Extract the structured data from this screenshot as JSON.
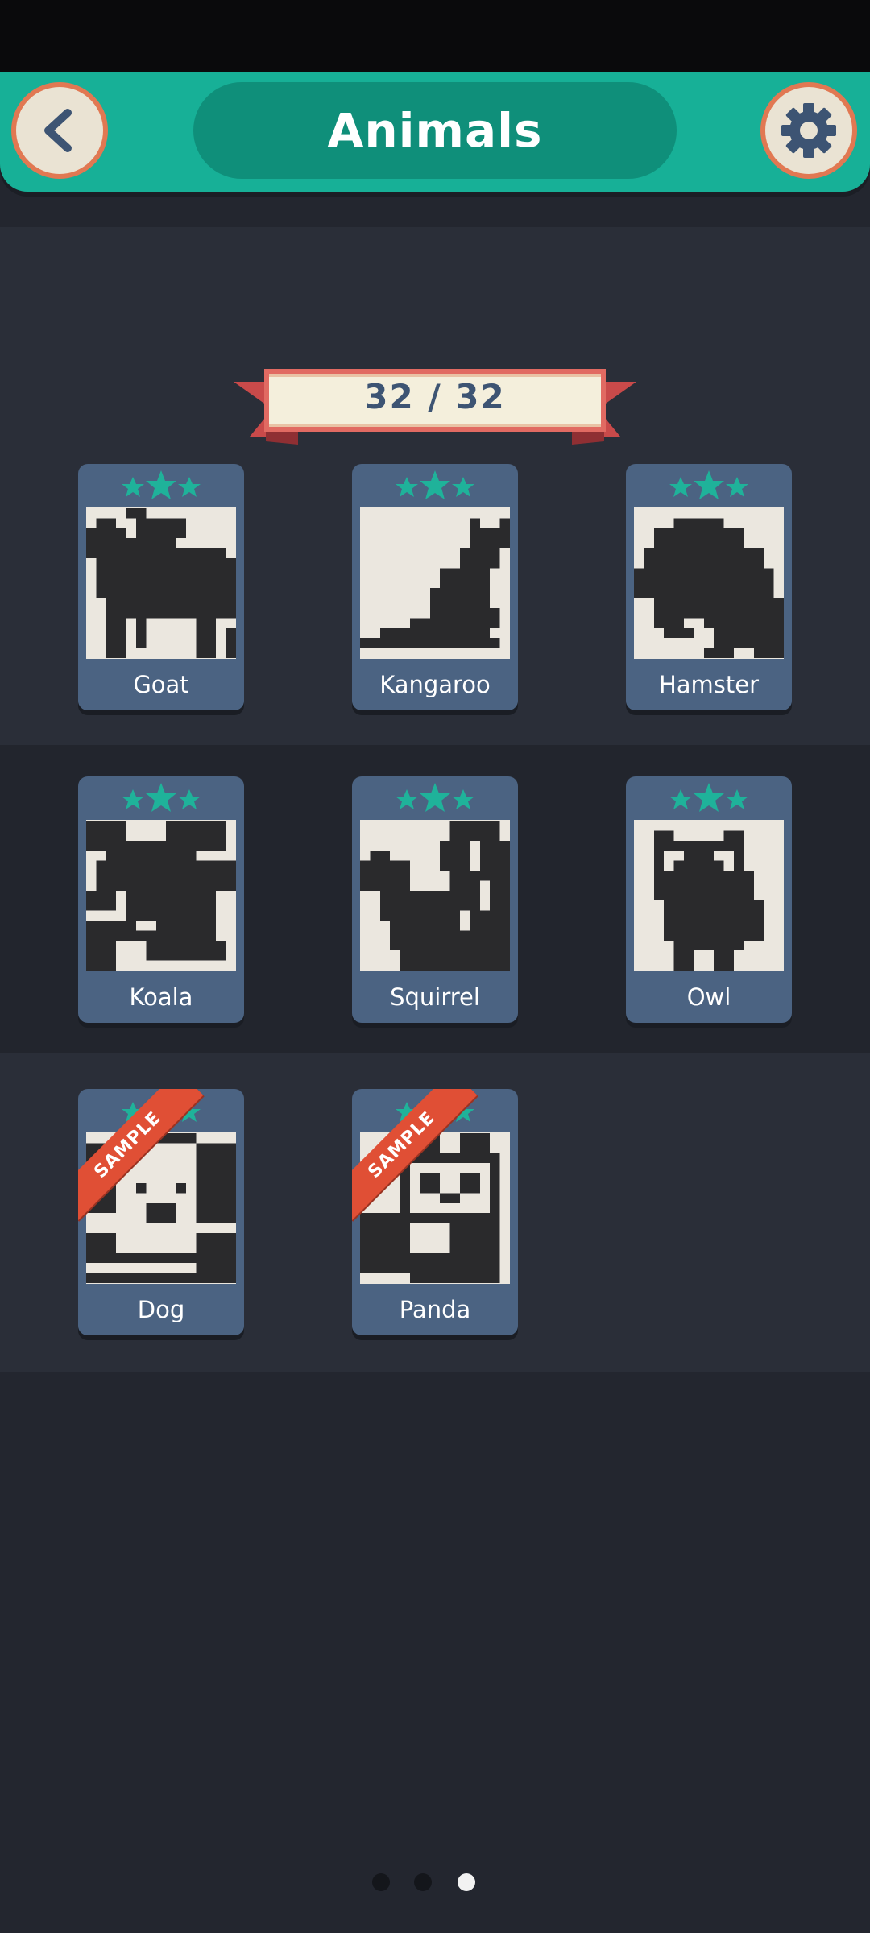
{
  "header": {
    "title": "Animals",
    "back_icon": "chevron-left-icon",
    "settings_icon": "gear-icon"
  },
  "progress": {
    "text": "32 / 32"
  },
  "colors": {
    "header_teal": "#17b097",
    "card_blue": "#4b6382",
    "star_teal": "#1fb29a",
    "sample_red": "#e04f35"
  },
  "puzzles": [
    {
      "label": "Goat",
      "stars": 3,
      "sample": false
    },
    {
      "label": "Kangaroo",
      "stars": 3,
      "sample": false
    },
    {
      "label": "Hamster",
      "stars": 3,
      "sample": false
    },
    {
      "label": "Koala",
      "stars": 3,
      "sample": false
    },
    {
      "label": "Squirrel",
      "stars": 3,
      "sample": false
    },
    {
      "label": "Owl",
      "stars": 3,
      "sample": false
    },
    {
      "label": "Dog",
      "stars": 3,
      "sample": true,
      "badge": "SAMPLE"
    },
    {
      "label": "Panda",
      "stars": 3,
      "sample": true,
      "badge": "SAMPLE"
    }
  ],
  "pagination": {
    "pages": 3,
    "current": 3
  }
}
